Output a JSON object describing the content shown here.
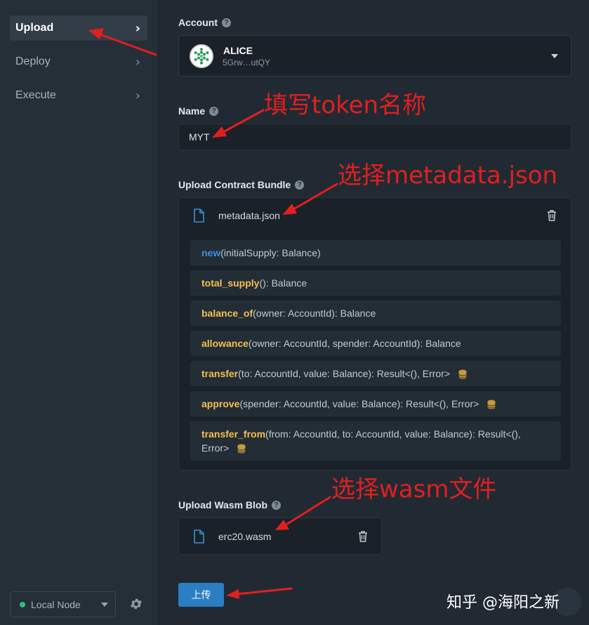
{
  "sidebar": {
    "items": [
      {
        "label": "Upload",
        "active": true
      },
      {
        "label": "Deploy",
        "active": false
      },
      {
        "label": "Execute",
        "active": false
      }
    ],
    "node_label": "Local Node",
    "node_status_color": "#2ec276",
    "settings_icon": "gear-icon"
  },
  "account": {
    "label": "Account",
    "name": "ALICE",
    "address": "5Grw…utQY"
  },
  "name_field": {
    "label": "Name",
    "value": "MYT"
  },
  "bundle": {
    "label": "Upload Contract Bundle",
    "file_name": "metadata.json",
    "messages": [
      {
        "name": "new",
        "signature": "(initialSupply: Balance)",
        "constructor": true,
        "mutates": false
      },
      {
        "name": "total_supply",
        "signature": "(): Balance",
        "constructor": false,
        "mutates": false
      },
      {
        "name": "balance_of",
        "signature": "(owner: AccountId): Balance",
        "constructor": false,
        "mutates": false
      },
      {
        "name": "allowance",
        "signature": "(owner: AccountId, spender: AccountId): Balance",
        "constructor": false,
        "mutates": false
      },
      {
        "name": "transfer",
        "signature": "(to: AccountId, value: Balance): Result<(), Error>",
        "constructor": false,
        "mutates": true
      },
      {
        "name": "approve",
        "signature": "(spender: AccountId, value: Balance): Result<(), Error>",
        "constructor": false,
        "mutates": true
      },
      {
        "name": "transfer_from",
        "signature": "(from: AccountId, to: AccountId, value: Balance): Result<(), Error>",
        "constructor": false,
        "mutates": true
      }
    ]
  },
  "wasm": {
    "label": "Upload Wasm Blob",
    "file_name": "erc20.wasm"
  },
  "upload_button": "上传",
  "annotations": {
    "name": "填写token名称",
    "metadata": "选择metadata.json",
    "wasm": "选择wasm文件"
  },
  "watermark": "知乎 @海阳之新",
  "colors": {
    "accent": "#2a7fc2",
    "message_name": "#f6c04d",
    "constructor_name": "#3d8fe0",
    "annotation": "#e21f1f"
  }
}
